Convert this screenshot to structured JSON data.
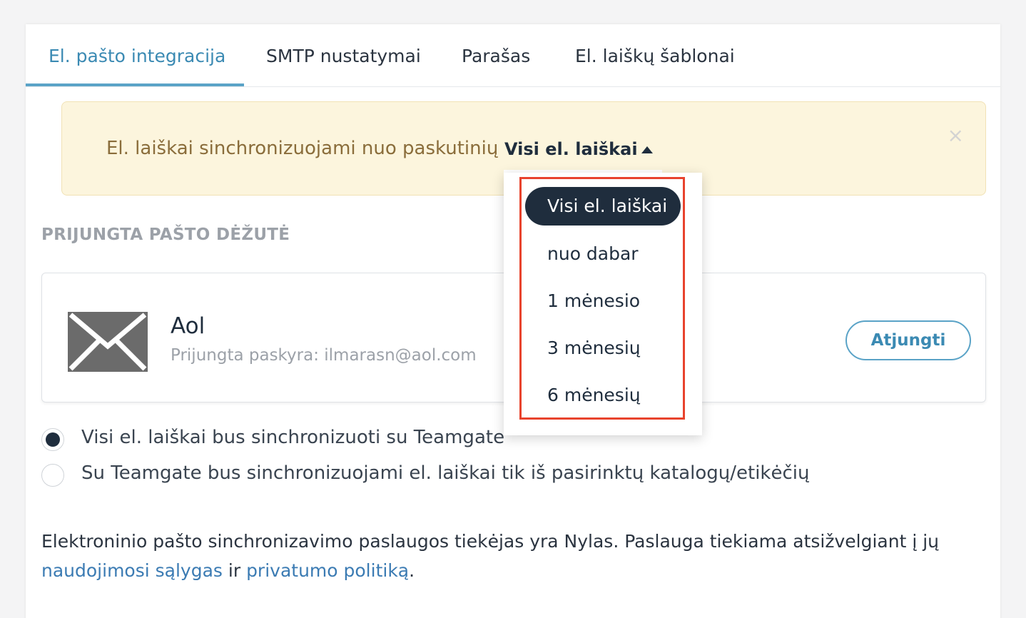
{
  "tabs": [
    {
      "label": "El. pašto integracija",
      "active": true
    },
    {
      "label": "SMTP nustatymai"
    },
    {
      "label": "Parašas"
    },
    {
      "label": "El. laiškų šablonai"
    }
  ],
  "banner": {
    "text": "El. laiškai sinchronizuojami nuo paskutinių",
    "selected": "Visi el. laiškai",
    "close": "×"
  },
  "section_title": "PRIJUNGTA PAŠTO DĖŽUTĖ",
  "account": {
    "name": "Aol",
    "subtitle": "Prijungta paskyra: ilmarasn@aol.com",
    "disconnect_label": "Atjungti"
  },
  "radios": [
    {
      "label": "Visi el. laiškai bus sinchronizuoti su Teamgate",
      "checked": true
    },
    {
      "label": "Su Teamgate bus sinchronizuojami el. laiškai tik iš pasirinktų katalogų/etikėčių",
      "checked": false
    }
  ],
  "footer": {
    "text_before": "Elektroninio pašto sinchronizavimo paslaugos tiekėjas yra Nylas. Paslauga tiekiama atsižvelgiant į jų ",
    "link_terms": "naudojimosi sąlygas",
    "text_mid": " ir ",
    "link_privacy": "privatumo politiką",
    "text_end": "."
  },
  "dropdown": {
    "options": [
      "Visi el. laiškai",
      "nuo dabar",
      "1 mėnesio",
      "3 mėnesių",
      "6 mėnesių"
    ],
    "selected_index": 0
  },
  "colors": {
    "accent": "#3b8ab3",
    "banner_bg": "#fcf5dd",
    "highlight": "#e8432d",
    "dark": "#1f2d3d"
  }
}
